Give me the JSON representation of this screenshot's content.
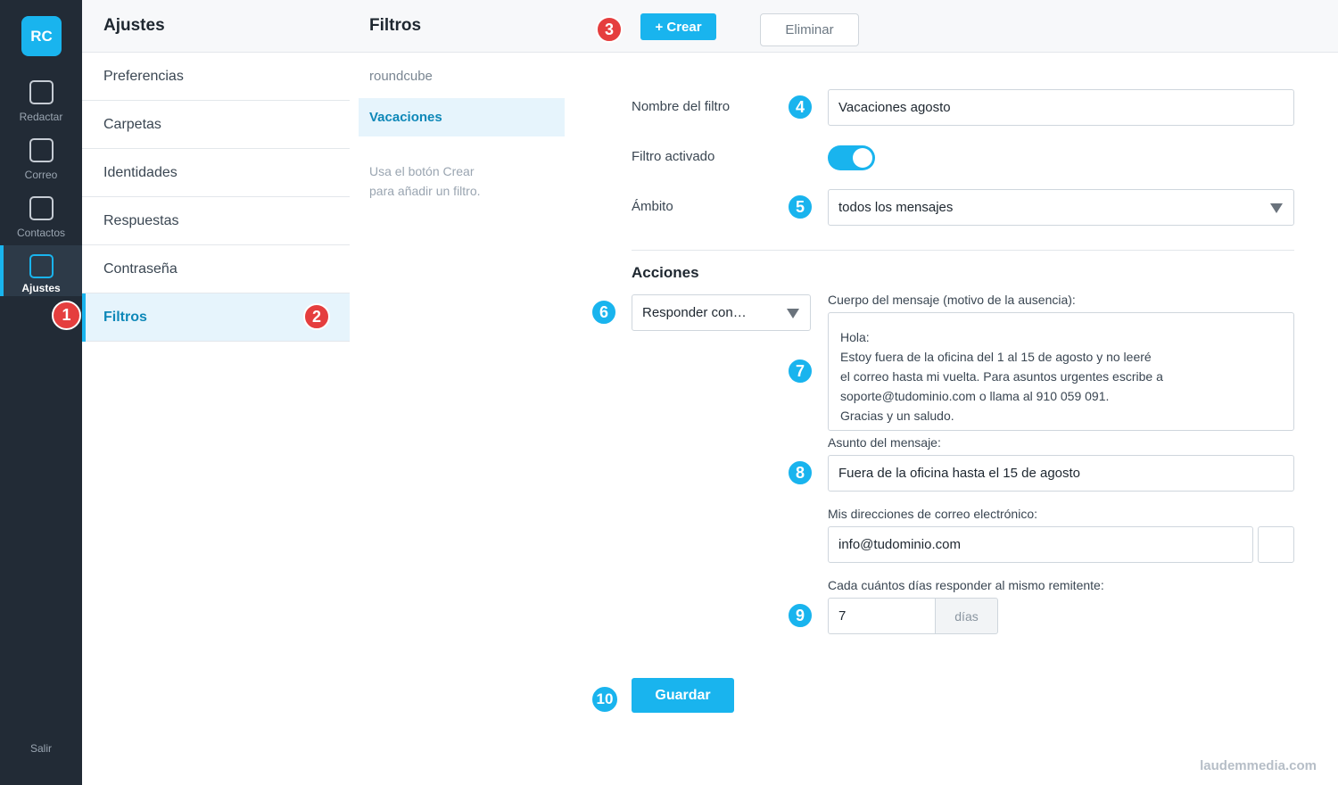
{
  "rail": {
    "logo": "RC",
    "items": [
      {
        "label": "Redactar",
        "icon": "compose-icon"
      },
      {
        "label": "Correo",
        "icon": "mail-icon"
      },
      {
        "label": "Contactos",
        "icon": "contacts-icon"
      },
      {
        "label": "Ajustes",
        "icon": "settings-icon"
      }
    ],
    "logout": "Salir"
  },
  "settings": {
    "title": "Ajustes",
    "items": [
      "Preferencias",
      "Carpetas",
      "Identidades",
      "Respuestas",
      "Contraseña",
      "Filtros"
    ],
    "active": "Filtros"
  },
  "filters": {
    "title": "Filtros",
    "group": "roundcube",
    "selected": "Vacaciones",
    "hint_line1": "Usa el botón Crear",
    "hint_line2": "para añadir un filtro."
  },
  "toolbar": {
    "create_label": "+  Crear",
    "delete_label": "Eliminar"
  },
  "form": {
    "name_label": "Nombre del filtro",
    "name_value": "Vacaciones agosto",
    "active_label": "Filtro activado",
    "active_value": true,
    "scope_label": "Ámbito",
    "scope_value": "todos los mensajes",
    "actions_title": "Acciones",
    "action_value": "Responder con…",
    "body_label": "Cuerpo del mensaje (motivo de la ausencia):",
    "body_lines": [
      "Hola:",
      "Estoy fuera de la oficina del 1 al 15 de agosto y no leeré",
      "el correo hasta mi vuelta. Para asuntos urgentes escribe a",
      "soporte@tudominio.com o llama al 910 059 091.",
      "Gracias y un saludo."
    ],
    "subject_label": "Asunto del mensaje:",
    "subject_value": "Fuera de la oficina hasta el 15 de agosto",
    "addresses_label": "Mis direcciones de correo electrónico:",
    "addresses_value": "info@tudominio.com",
    "days_label": "Cada cuántos días responder al mismo remitente:",
    "days_value": "7",
    "days_unit": "días",
    "save_label": "Guardar"
  },
  "badges": [
    "1",
    "2",
    "3",
    "4",
    "5",
    "6",
    "7",
    "8",
    "9",
    "10"
  ],
  "watermark": "laudemmedia.com",
  "colors": {
    "accent": "#19b4ee",
    "rail": "#222b36",
    "badge_red": "#e53e3e"
  }
}
